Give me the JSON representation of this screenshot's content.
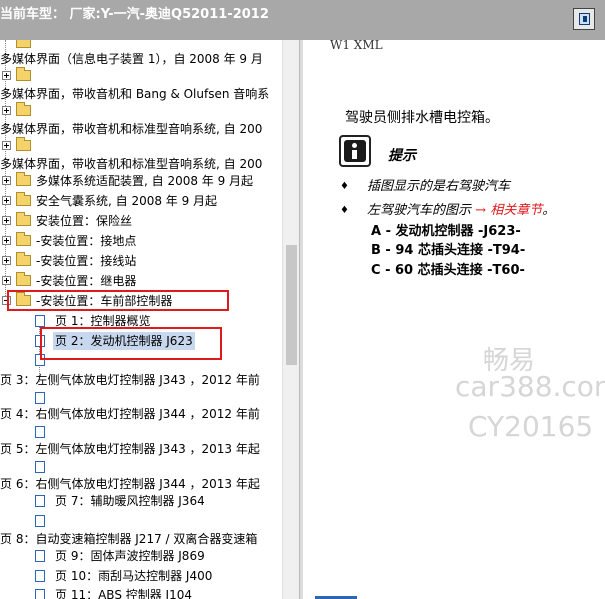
{
  "title_bar": {
    "text": "当前车型： 厂家:Y-一汽-奥迪Q52011-2012"
  },
  "tree": [
    {
      "text": ""
    },
    {
      "text": "多媒体界面（信息电子装置 1），自 2008 年 9 月"
    },
    {
      "text": "多媒体界面，带收音机和 Bang & Olufsen 音响系"
    },
    {
      "text": "多媒体界面，带收音机和标准型音响系统, 自 200"
    },
    {
      "text": "多媒体界面，带收音机和标准型音响系统, 自 200"
    },
    {
      "text": "多媒体系统适配装置, 自 2008 年 9 月起"
    },
    {
      "text": "安全气囊系统, 自 2008 年 9 月起"
    },
    {
      "text": "安装位置：保险丝"
    },
    {
      "text": "-安装位置：接地点"
    },
    {
      "text": "-安装位置：接线站"
    },
    {
      "text": "-安装位置：继电器"
    },
    {
      "text": "-安装位置：车前部控制器"
    },
    {
      "text": "页 1：控制器概览"
    },
    {
      "text": "页 2：发动机控制器 J623"
    },
    {
      "text": "页 3：左侧气体放电灯控制器 J343 ，2012 年前"
    },
    {
      "text": "页 4：右侧气体放电灯控制器 J344 ，2012 年前"
    },
    {
      "text": "页 5：左侧气体放电灯控制器 J343 ，2013 年起"
    },
    {
      "text": "页 6：右侧气体放电灯控制器 J344 ，2013 年起"
    },
    {
      "text": "页 7：辅助暖风控制器 J364"
    },
    {
      "text": "页 8：自动变速箱控制器 J217 / 双离合器变速箱"
    },
    {
      "text": "页 9：固体声波控制器 J869"
    },
    {
      "text": "页 10：雨刮马达控制器 J400"
    },
    {
      "text": "页 11：ABS 控制器 J104"
    }
  ],
  "doc": {
    "header": "W1  XML",
    "title": "驾驶员侧排水槽电控箱。",
    "tip_label": "提示",
    "bullet1": "插图显示的是右驾驶汽车",
    "bullet2_prefix": "左驾驶汽车的图示",
    "bullet2_arrow": "→",
    "bullet2_link": "相关章节",
    "bullet2_suffix": "。",
    "bullet_glyph": "♦",
    "items": [
      "A - 发动机控制器 -J623-",
      "B - 94 芯插头连接 -T94-",
      "C - 60 芯插头连接 -T60-"
    ]
  },
  "watermark": {
    "line1": "畅易",
    "line2": "car388.com",
    "line3": "CY20165"
  },
  "colors": {
    "title_bar": "#a8a8a8",
    "highlight_box": "#e0191d",
    "link": "#e0191d",
    "selection": "#c7d7ee"
  }
}
